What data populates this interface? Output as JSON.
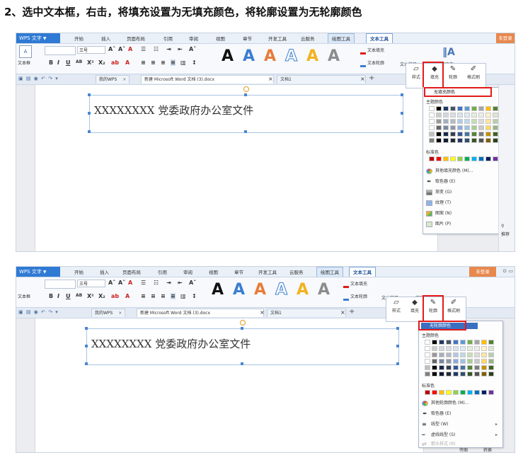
{
  "heading": "2、选中文本框，右击，将填充设置为无填充颜色，将轮廓设置为无轮廓颜色",
  "app": {
    "logo": "WPS 文字",
    "menu_tabs": [
      "开始",
      "插入",
      "页面布局",
      "引用",
      "审阅",
      "视图",
      "章节",
      "开发工具",
      "云服务",
      "绘图工具",
      "文本工具"
    ],
    "login_label": "未登录"
  },
  "toolbar": {
    "textbox_label": "文本框",
    "font_size": "三号",
    "text_fill": "文本填充",
    "text_outline": "文本轮廓",
    "text_effect": "文本效果",
    "text_direction": "文字方向"
  },
  "doc_tabs": {
    "mywps": "我的WPS",
    "main_doc": "新建 Microsoft Word 文档 (3).docx",
    "doc1": "文档1"
  },
  "document": {
    "textbox_content": "XXXXXXXX 党委政府办公室文件"
  },
  "mini_toolbar": {
    "style": "样式",
    "fill": "填充",
    "outline": "轮廓",
    "format_painter": "格式刷"
  },
  "fill_menu": {
    "first": "无填充颜色",
    "theme_colors": "主题颜色",
    "standard_colors": "标准色",
    "items": [
      "其他填充颜色 (M)...",
      "取色器 (E)",
      "渐变 (G)",
      "纹理 (T)",
      "图案 (N)",
      "图片 (P)"
    ]
  },
  "outline_menu": {
    "first": "无轮廓颜色",
    "theme_colors": "主题颜色",
    "standard_colors": "标准色",
    "items": [
      "其他轮廓颜色 (M)...",
      "取色器 (E)",
      "线型 (W)",
      "虚线线型 (S)",
      "箭头样式 (R)"
    ]
  },
  "side_panel": {
    "recommend": "推荐",
    "convert": "转换",
    "layout": "传图"
  },
  "colors": {
    "theme_row": [
      "#ffffff",
      "#000000",
      "#1f3864",
      "#44546a",
      "#4472c4",
      "#5b9bd5",
      "#70ad47",
      "#a5a5a5",
      "#ffc000",
      "#548235"
    ],
    "standard_row": [
      "#c00000",
      "#ff0000",
      "#ffc000",
      "#ffff00",
      "#92d050",
      "#00b050",
      "#00b0f0",
      "#0070c0",
      "#002060",
      "#7030a0"
    ],
    "accent_red": "#e21b1b",
    "wps_blue": "#2f7ad4"
  }
}
